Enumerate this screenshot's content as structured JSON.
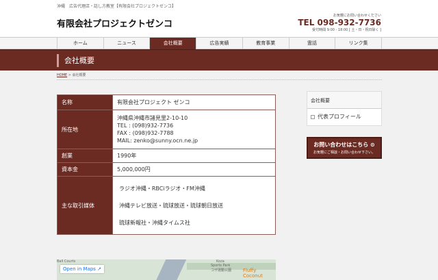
{
  "topbar": {
    "text": "沖縄　広告代理店・話し方教室【有限会社プロジェクトゼンコ】"
  },
  "header": {
    "logo": "有限会社プロジェクトゼンコ",
    "contact_note": "お気軽にお問い合わせください",
    "tel": "TEL 098-932-7736",
    "hours": "受付時間 9:00 - 18:00 [ 土・日・祝日除く ]"
  },
  "nav": {
    "items": [
      {
        "label": "ホーム",
        "active": false
      },
      {
        "label": "ニュース",
        "active": false
      },
      {
        "label": "会社概要",
        "active": true
      },
      {
        "label": "広告実績",
        "active": false
      },
      {
        "label": "教育事業",
        "active": false
      },
      {
        "label": "霊話",
        "active": false
      },
      {
        "label": "リンク集",
        "active": false
      }
    ]
  },
  "banner": {
    "title": "会社概要"
  },
  "breadcrumb": {
    "home": "HOME",
    "sep": " > ",
    "current": "会社概要"
  },
  "company": {
    "name_label": "名称",
    "name_value": "有限会社プロジェクト ゼンコ",
    "address_label": "所在地",
    "address_lines": [
      "沖縄県沖縄市諸見里2-10-10",
      "TEL : (098)932-7736",
      "FAX : (098)932-7788",
      "MAIL: zenko@sunny.ocn.ne.jp"
    ],
    "founded_label": "創業",
    "founded_value": "1990年",
    "capital_label": "資本金",
    "capital_value": "5,000,000円",
    "media_label": "主な取引媒体",
    "media_lines": [
      "ラジオ沖縄・RBCiラジオ・FM沖縄",
      "沖縄テレビ放送・琉球放送・琉球朝日放送",
      "琉球新報社・沖縄タイムス社"
    ]
  },
  "sidebar": {
    "title": "会社概要",
    "item": "代表プロフィール",
    "cta_big": "お問い合わせはこちら ⊙",
    "cta_small": "お気軽にご相談・お問い合わせ下さい。"
  },
  "map": {
    "open_label": "Open in Maps ↗",
    "label_courts": "Ball Courts",
    "label_park1": "Koza",
    "label_park2": "Sports Park",
    "label_park3": "コザ運動公園",
    "label_cafe": "Fluffy Coconut"
  },
  "colors": {
    "brand": "#6b2a22",
    "page_bg": "#f1f1f1"
  }
}
